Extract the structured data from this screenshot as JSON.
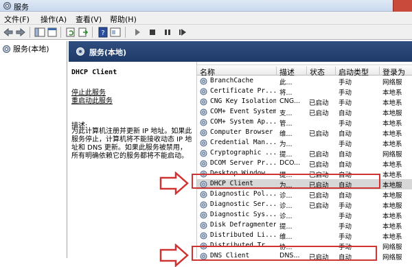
{
  "window": {
    "title": "服务"
  },
  "menu": [
    "文件(F)",
    "操作(A)",
    "查看(V)",
    "帮助(H)"
  ],
  "tree": {
    "root_label": "服务(本地)"
  },
  "main": {
    "header": "服务(本地)"
  },
  "desc": {
    "service_name": "DHCP Client",
    "stop_link": "停止此服务",
    "restart_link": "重启动此服务",
    "desc_label": "描述:",
    "desc_text": "为此计算机注册并更新 IP 地址。如果此服务停止，计算机将不能接收动态 IP 地址和 DNS 更新。如果此服务被禁用，所有明确依赖它的服务都将不能启动。"
  },
  "columns": [
    "名称",
    "描述",
    "状态",
    "启动类型",
    "登录为"
  ],
  "rows": [
    {
      "name": "BranchCache",
      "desc": "此...",
      "status": "",
      "startup": "手动",
      "logon": "网络服"
    },
    {
      "name": "Certificate Pr...",
      "desc": "将...",
      "status": "",
      "startup": "手动",
      "logon": "本地系"
    },
    {
      "name": "CNG Key Isolation",
      "desc": "CNG...",
      "status": "已启动",
      "startup": "手动",
      "logon": "本地系"
    },
    {
      "name": "COM+ Event System",
      "desc": "支...",
      "status": "已启动",
      "startup": "自动",
      "logon": "本地服"
    },
    {
      "name": "COM+ System Ap...",
      "desc": "管...",
      "status": "",
      "startup": "手动",
      "logon": "本地系"
    },
    {
      "name": "Computer Browser",
      "desc": "维...",
      "status": "已启动",
      "startup": "自动",
      "logon": "本地系"
    },
    {
      "name": "Credential Man...",
      "desc": "为...",
      "status": "",
      "startup": "手动",
      "logon": "本地系"
    },
    {
      "name": "Cryptographic ...",
      "desc": "提...",
      "status": "已启动",
      "startup": "自动",
      "logon": "网络服"
    },
    {
      "name": "DCOM Server Pr...",
      "desc": "DCO...",
      "status": "已启动",
      "startup": "自动",
      "logon": "本地系"
    },
    {
      "name": "Desktop Window...",
      "desc": "提...",
      "status": "已启动",
      "startup": "自动",
      "logon": "本地系"
    },
    {
      "name": "DHCP Client",
      "desc": "为...",
      "status": "已启动",
      "startup": "自动",
      "logon": "本地服"
    },
    {
      "name": "Diagnostic Pol...",
      "desc": "诊...",
      "status": "已启动",
      "startup": "自动",
      "logon": "本地服"
    },
    {
      "name": "Diagnostic Ser...",
      "desc": "诊...",
      "status": "已启动",
      "startup": "手动",
      "logon": "本地服"
    },
    {
      "name": "Diagnostic Sys...",
      "desc": "诊...",
      "status": "",
      "startup": "手动",
      "logon": "本地系"
    },
    {
      "name": "Disk Defragmenter",
      "desc": "提...",
      "status": "",
      "startup": "手动",
      "logon": "本地系"
    },
    {
      "name": "Distributed Li...",
      "desc": "维...",
      "status": "",
      "startup": "手动",
      "logon": "本地系"
    },
    {
      "name": "Distributed Tr...",
      "desc": "协...",
      "status": "",
      "startup": "手动",
      "logon": "网络服"
    },
    {
      "name": "DNS Client",
      "desc": "DNS...",
      "status": "已启动",
      "startup": "自动",
      "logon": "网络服"
    }
  ],
  "colors": {
    "highlight": "#d03232",
    "header_bg": "#1f3a68",
    "selection": "#d7d7d7"
  }
}
